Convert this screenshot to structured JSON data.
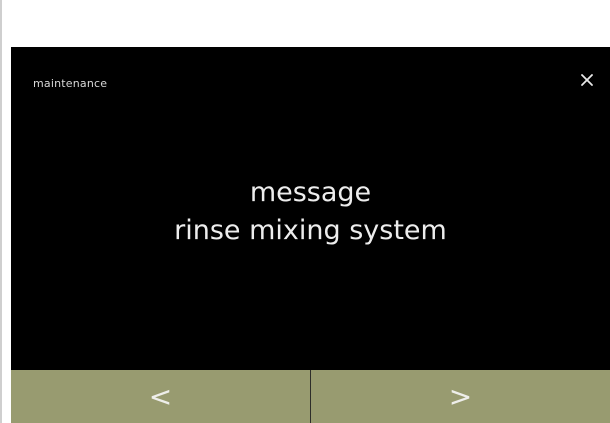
{
  "header": {
    "title": "maintenance",
    "close_icon": "close-icon"
  },
  "message": {
    "line1": "message",
    "line2": "rinse mixing system"
  },
  "nav": {
    "prev_label": "<",
    "next_label": ">"
  },
  "colors": {
    "screen_background": "#000000",
    "nav_bar": "#989b70",
    "text": "#ededed"
  }
}
